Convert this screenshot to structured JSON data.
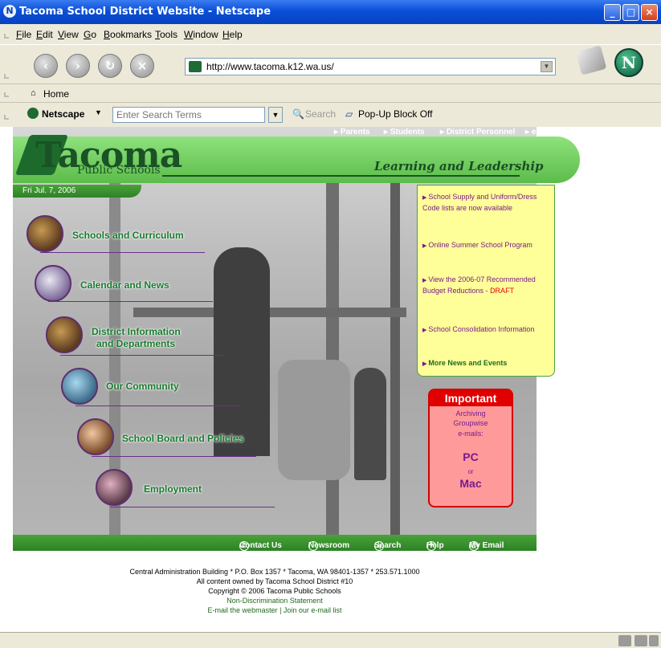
{
  "window": {
    "title": "Tacoma School District Website - Netscape"
  },
  "menu": [
    "File",
    "Edit",
    "View",
    "Go",
    "Bookmarks",
    "Tools",
    "Window",
    "Help"
  ],
  "nav": {
    "url": "http://www.tacoma.k12.wa.us/"
  },
  "personal": {
    "home": "Home"
  },
  "search": {
    "brand": "Netscape",
    "placeholder": "Enter Search Terms",
    "button": "Search",
    "popup": "Pop-Up Block Off"
  },
  "site": {
    "toplinks": [
      "Parents",
      "Students",
      "District Personnel",
      "eSIS"
    ],
    "logo": {
      "main": "Tacoma",
      "sub": "Public Schools"
    },
    "tagline": "Learning and Leadership",
    "date": "Fri Jul. 7, 2006",
    "menu": [
      "Schools and Curriculum",
      "Calendar and News",
      "District Information",
      "and Departments",
      "Our Community",
      "School Board and Policies",
      "Employment"
    ],
    "news": {
      "n1": "School Supply and Uniform/Dress Code lists are now available",
      "n2": "Online Summer School Program",
      "n3a": "View the 2006-07 Recommended Budget Reductions - ",
      "n3b": "DRAFT",
      "n4": "School Consolidation Information",
      "n5": "More News and Events"
    },
    "important": {
      "title": "Important",
      "l1": "Archiving",
      "l2": "Groupwise",
      "l3": "e-mails:",
      "pc": "PC",
      "or": "or",
      "mac": "Mac"
    },
    "bottom": [
      "Contact Us",
      "Newsroom",
      "Search",
      "Help",
      "My Email"
    ],
    "footer": {
      "l1": "Central Administration Building * P.O. Box 1357 * Tacoma, WA 98401-1357 * 253.571.1000",
      "l2": "All content owned by Tacoma School District #10",
      "l3": "Copyright © 2006 Tacoma Public Schools",
      "l4": "Non-Discrimination Statement",
      "l5": "E-mail the webmaster | Join our e-mail list"
    }
  },
  "icons": [
    "netscape-icon",
    "back-icon",
    "forward-icon",
    "reload-icon",
    "stop-icon",
    "page-icon",
    "print-icon",
    "netscape-n-icon",
    "home-icon",
    "search-icon",
    "popup-icon"
  ],
  "colors": {
    "titlebar": "#0a4fd8",
    "green": "#4aa23a",
    "news_bg": "#ffff99",
    "important": "#e00000",
    "link_purple": "#7a1a8c"
  }
}
